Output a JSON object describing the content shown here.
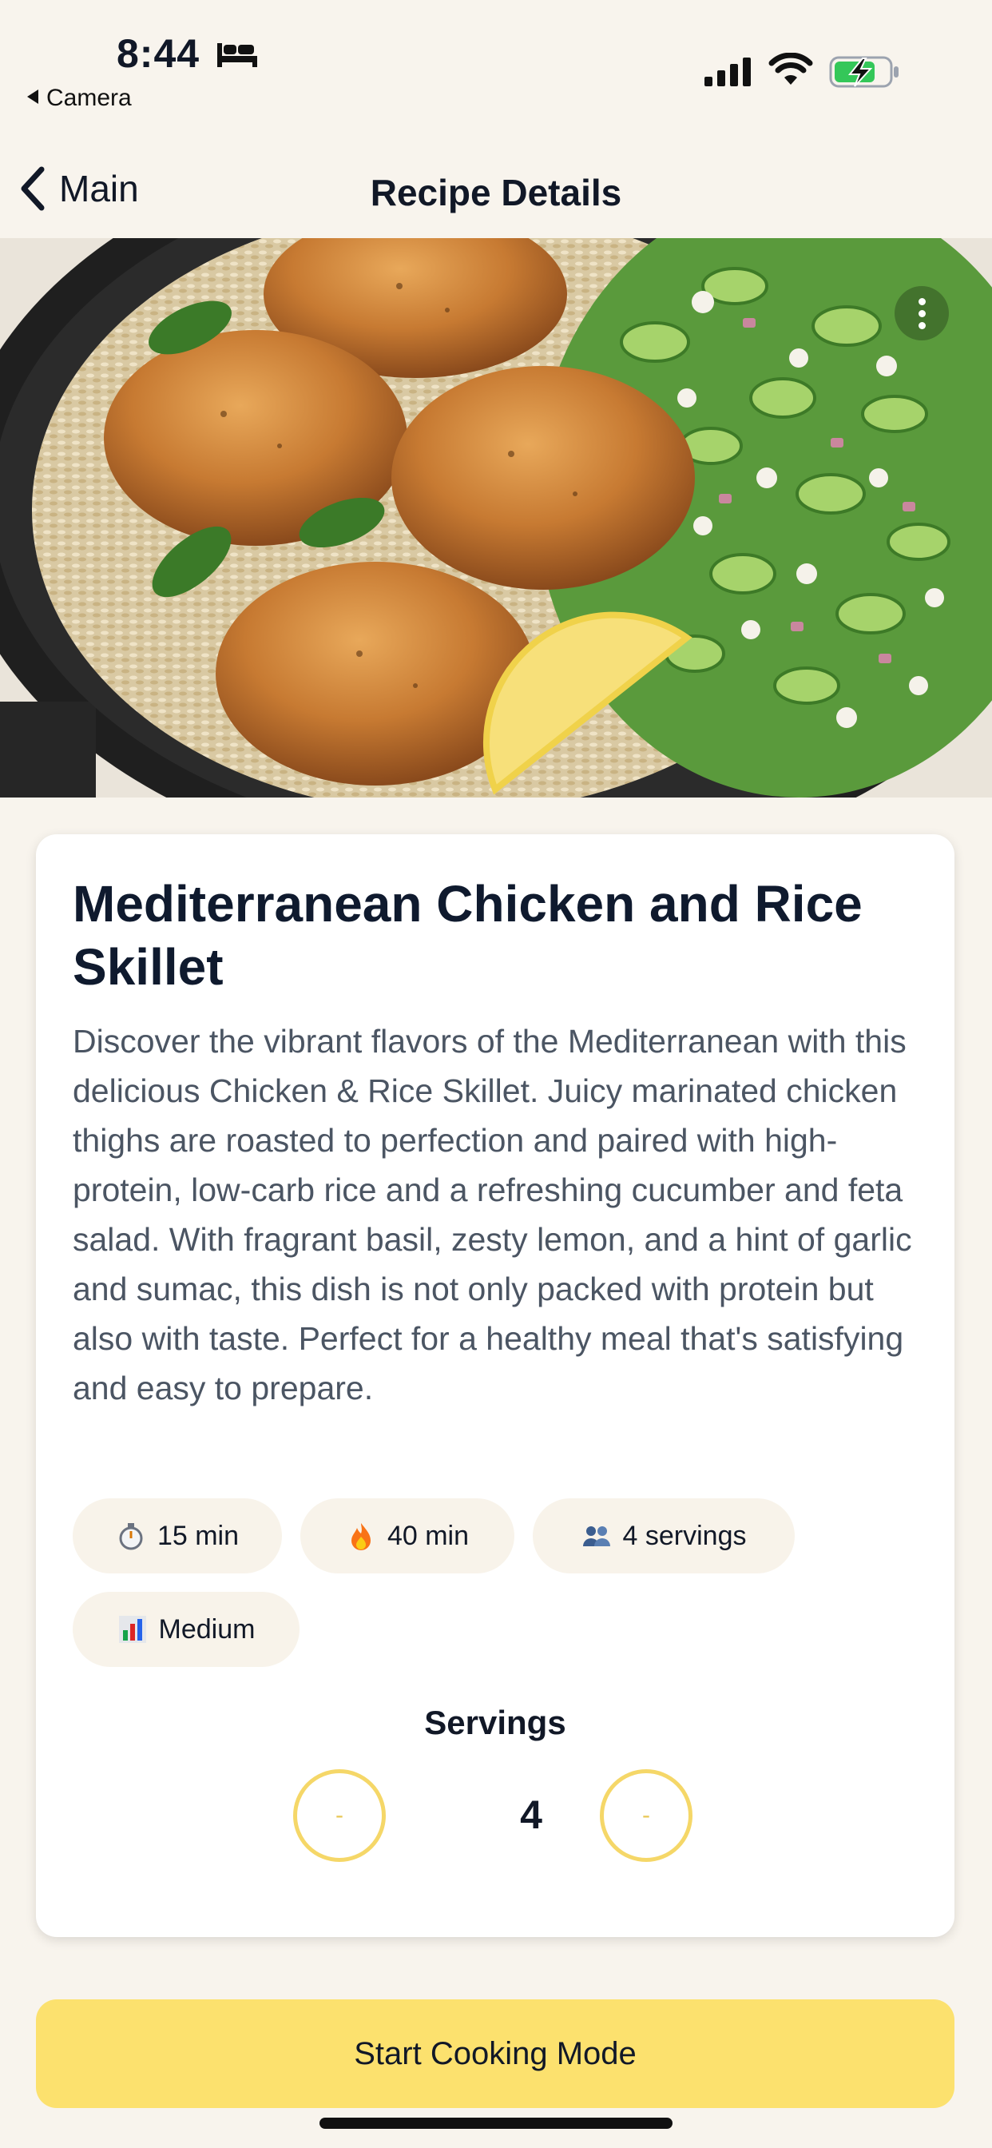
{
  "status_bar": {
    "time": "8:44",
    "back_app": "Camera",
    "battery_color": "#34c759"
  },
  "nav": {
    "back_label": "Main",
    "title": "Recipe Details"
  },
  "recipe": {
    "title": "Mediterranean Chicken and Rice Skillet",
    "description": "Discover the vibrant flavors of the Mediterranean with this delicious Chicken & Rice Skillet. Juicy marinated chicken thighs are roasted to perfection and paired with high-protein, low-carb rice and a refreshing cucumber and feta salad. With fragrant basil, zesty lemon, and a hint of garlic and sumac, this dish is not only packed with protein but also with taste. Perfect for a healthy meal that's satisfying and easy to prepare.",
    "chips": [
      {
        "icon": "stopwatch-icon",
        "label": "15 min"
      },
      {
        "icon": "fire-icon",
        "label": "40 min"
      },
      {
        "icon": "people-icon",
        "label": "4 servings"
      },
      {
        "icon": "bar-chart-icon",
        "label": "Medium"
      }
    ]
  },
  "servings": {
    "label": "Servings",
    "value": "4",
    "decrement_label": "-",
    "increment_label": "-"
  },
  "cta": {
    "label": "Start Cooking Mode"
  },
  "colors": {
    "accent": "#fce16e",
    "stepper_border": "#f5d768",
    "background": "#f8f4ed"
  }
}
